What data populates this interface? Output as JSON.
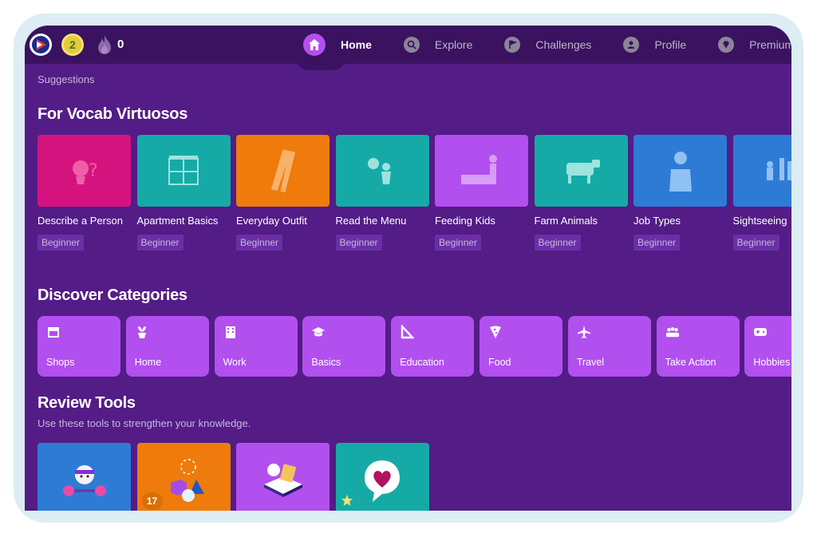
{
  "topbar": {
    "level": "2",
    "streak": "0",
    "nav": [
      {
        "label": "Home",
        "icon": "home-icon",
        "active": true
      },
      {
        "label": "Explore",
        "icon": "search-icon",
        "active": false
      },
      {
        "label": "Challenges",
        "icon": "flag-icon",
        "active": false
      },
      {
        "label": "Profile",
        "icon": "user-icon",
        "active": false
      },
      {
        "label": "Premium",
        "icon": "diamond-icon",
        "active": false
      }
    ]
  },
  "suggestions_label": "Suggestions",
  "vocab": {
    "title": "For Vocab Virtuosos",
    "cards": [
      {
        "title": "Describe a Person",
        "level": "Beginner",
        "color": "#d4137f"
      },
      {
        "title": "Apartment Basics",
        "level": "Beginner",
        "color": "#16aaa6"
      },
      {
        "title": "Everyday Outfit",
        "level": "Beginner",
        "color": "#ee7b0b"
      },
      {
        "title": "Read the Menu",
        "level": "Beginner",
        "color": "#16aaa6"
      },
      {
        "title": "Feeding Kids",
        "level": "Beginner",
        "color": "#b24fef"
      },
      {
        "title": "Farm Animals",
        "level": "Beginner",
        "color": "#16aaa6"
      },
      {
        "title": "Job Types",
        "level": "Beginner",
        "color": "#2e7bd6"
      },
      {
        "title": "Sightseeing",
        "level": "Beginner",
        "color": "#2e7bd6"
      }
    ]
  },
  "categories": {
    "title": "Discover Categories",
    "items": [
      {
        "label": "Shops",
        "icon": "shop-icon"
      },
      {
        "label": "Home",
        "icon": "plant-icon"
      },
      {
        "label": "Work",
        "icon": "building-icon"
      },
      {
        "label": "Basics",
        "icon": "graduation-cap-icon"
      },
      {
        "label": "Education",
        "icon": "set-square-icon"
      },
      {
        "label": "Food",
        "icon": "pizza-icon"
      },
      {
        "label": "Travel",
        "icon": "airplane-icon"
      },
      {
        "label": "Take Action",
        "icon": "people-icon"
      },
      {
        "label": "Hobbies",
        "icon": "gamepad-icon"
      }
    ]
  },
  "review": {
    "title": "Review Tools",
    "subtitle": "Use these tools to strengthen your knowledge.",
    "tools": [
      {
        "color": "#2e7bd6",
        "icon": "dumbbell-character-icon"
      },
      {
        "color": "#ee7b0b",
        "icon": "shapes-icon",
        "badge": "17"
      },
      {
        "color": "#b24fef",
        "icon": "book-icon"
      },
      {
        "color": "#16aaa6",
        "icon": "heart-bubble-icon"
      }
    ]
  }
}
